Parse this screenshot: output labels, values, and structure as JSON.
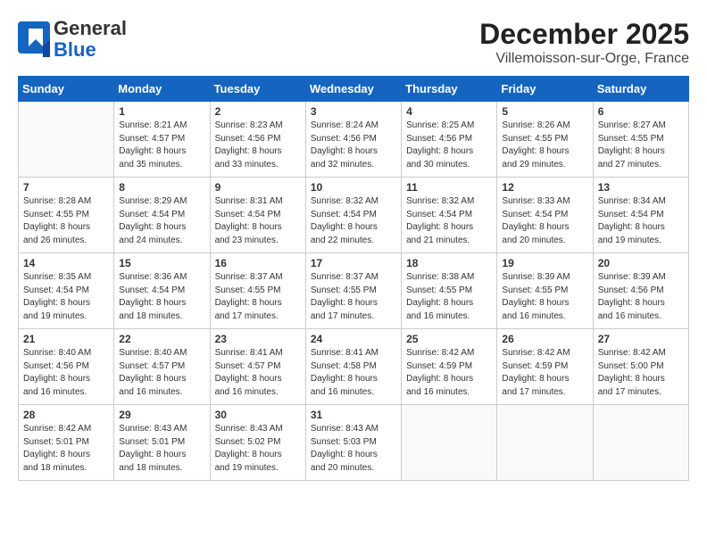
{
  "header": {
    "logo_general": "General",
    "logo_blue": "Blue",
    "month": "December 2025",
    "location": "Villemoisson-sur-Orge, France"
  },
  "days_of_week": [
    "Sunday",
    "Monday",
    "Tuesday",
    "Wednesday",
    "Thursday",
    "Friday",
    "Saturday"
  ],
  "weeks": [
    [
      {
        "day": "",
        "text": ""
      },
      {
        "day": "1",
        "text": "Sunrise: 8:21 AM\nSunset: 4:57 PM\nDaylight: 8 hours\nand 35 minutes."
      },
      {
        "day": "2",
        "text": "Sunrise: 8:23 AM\nSunset: 4:56 PM\nDaylight: 8 hours\nand 33 minutes."
      },
      {
        "day": "3",
        "text": "Sunrise: 8:24 AM\nSunset: 4:56 PM\nDaylight: 8 hours\nand 32 minutes."
      },
      {
        "day": "4",
        "text": "Sunrise: 8:25 AM\nSunset: 4:56 PM\nDaylight: 8 hours\nand 30 minutes."
      },
      {
        "day": "5",
        "text": "Sunrise: 8:26 AM\nSunset: 4:55 PM\nDaylight: 8 hours\nand 29 minutes."
      },
      {
        "day": "6",
        "text": "Sunrise: 8:27 AM\nSunset: 4:55 PM\nDaylight: 8 hours\nand 27 minutes."
      }
    ],
    [
      {
        "day": "7",
        "text": "Sunrise: 8:28 AM\nSunset: 4:55 PM\nDaylight: 8 hours\nand 26 minutes."
      },
      {
        "day": "8",
        "text": "Sunrise: 8:29 AM\nSunset: 4:54 PM\nDaylight: 8 hours\nand 24 minutes."
      },
      {
        "day": "9",
        "text": "Sunrise: 8:31 AM\nSunset: 4:54 PM\nDaylight: 8 hours\nand 23 minutes."
      },
      {
        "day": "10",
        "text": "Sunrise: 8:32 AM\nSunset: 4:54 PM\nDaylight: 8 hours\nand 22 minutes."
      },
      {
        "day": "11",
        "text": "Sunrise: 8:32 AM\nSunset: 4:54 PM\nDaylight: 8 hours\nand 21 minutes."
      },
      {
        "day": "12",
        "text": "Sunrise: 8:33 AM\nSunset: 4:54 PM\nDaylight: 8 hours\nand 20 minutes."
      },
      {
        "day": "13",
        "text": "Sunrise: 8:34 AM\nSunset: 4:54 PM\nDaylight: 8 hours\nand 19 minutes."
      }
    ],
    [
      {
        "day": "14",
        "text": "Sunrise: 8:35 AM\nSunset: 4:54 PM\nDaylight: 8 hours\nand 19 minutes."
      },
      {
        "day": "15",
        "text": "Sunrise: 8:36 AM\nSunset: 4:54 PM\nDaylight: 8 hours\nand 18 minutes."
      },
      {
        "day": "16",
        "text": "Sunrise: 8:37 AM\nSunset: 4:55 PM\nDaylight: 8 hours\nand 17 minutes."
      },
      {
        "day": "17",
        "text": "Sunrise: 8:37 AM\nSunset: 4:55 PM\nDaylight: 8 hours\nand 17 minutes."
      },
      {
        "day": "18",
        "text": "Sunrise: 8:38 AM\nSunset: 4:55 PM\nDaylight: 8 hours\nand 16 minutes."
      },
      {
        "day": "19",
        "text": "Sunrise: 8:39 AM\nSunset: 4:55 PM\nDaylight: 8 hours\nand 16 minutes."
      },
      {
        "day": "20",
        "text": "Sunrise: 8:39 AM\nSunset: 4:56 PM\nDaylight: 8 hours\nand 16 minutes."
      }
    ],
    [
      {
        "day": "21",
        "text": "Sunrise: 8:40 AM\nSunset: 4:56 PM\nDaylight: 8 hours\nand 16 minutes."
      },
      {
        "day": "22",
        "text": "Sunrise: 8:40 AM\nSunset: 4:57 PM\nDaylight: 8 hours\nand 16 minutes."
      },
      {
        "day": "23",
        "text": "Sunrise: 8:41 AM\nSunset: 4:57 PM\nDaylight: 8 hours\nand 16 minutes."
      },
      {
        "day": "24",
        "text": "Sunrise: 8:41 AM\nSunset: 4:58 PM\nDaylight: 8 hours\nand 16 minutes."
      },
      {
        "day": "25",
        "text": "Sunrise: 8:42 AM\nSunset: 4:59 PM\nDaylight: 8 hours\nand 16 minutes."
      },
      {
        "day": "26",
        "text": "Sunrise: 8:42 AM\nSunset: 4:59 PM\nDaylight: 8 hours\nand 17 minutes."
      },
      {
        "day": "27",
        "text": "Sunrise: 8:42 AM\nSunset: 5:00 PM\nDaylight: 8 hours\nand 17 minutes."
      }
    ],
    [
      {
        "day": "28",
        "text": "Sunrise: 8:42 AM\nSunset: 5:01 PM\nDaylight: 8 hours\nand 18 minutes."
      },
      {
        "day": "29",
        "text": "Sunrise: 8:43 AM\nSunset: 5:01 PM\nDaylight: 8 hours\nand 18 minutes."
      },
      {
        "day": "30",
        "text": "Sunrise: 8:43 AM\nSunset: 5:02 PM\nDaylight: 8 hours\nand 19 minutes."
      },
      {
        "day": "31",
        "text": "Sunrise: 8:43 AM\nSunset: 5:03 PM\nDaylight: 8 hours\nand 20 minutes."
      },
      {
        "day": "",
        "text": ""
      },
      {
        "day": "",
        "text": ""
      },
      {
        "day": "",
        "text": ""
      }
    ]
  ]
}
